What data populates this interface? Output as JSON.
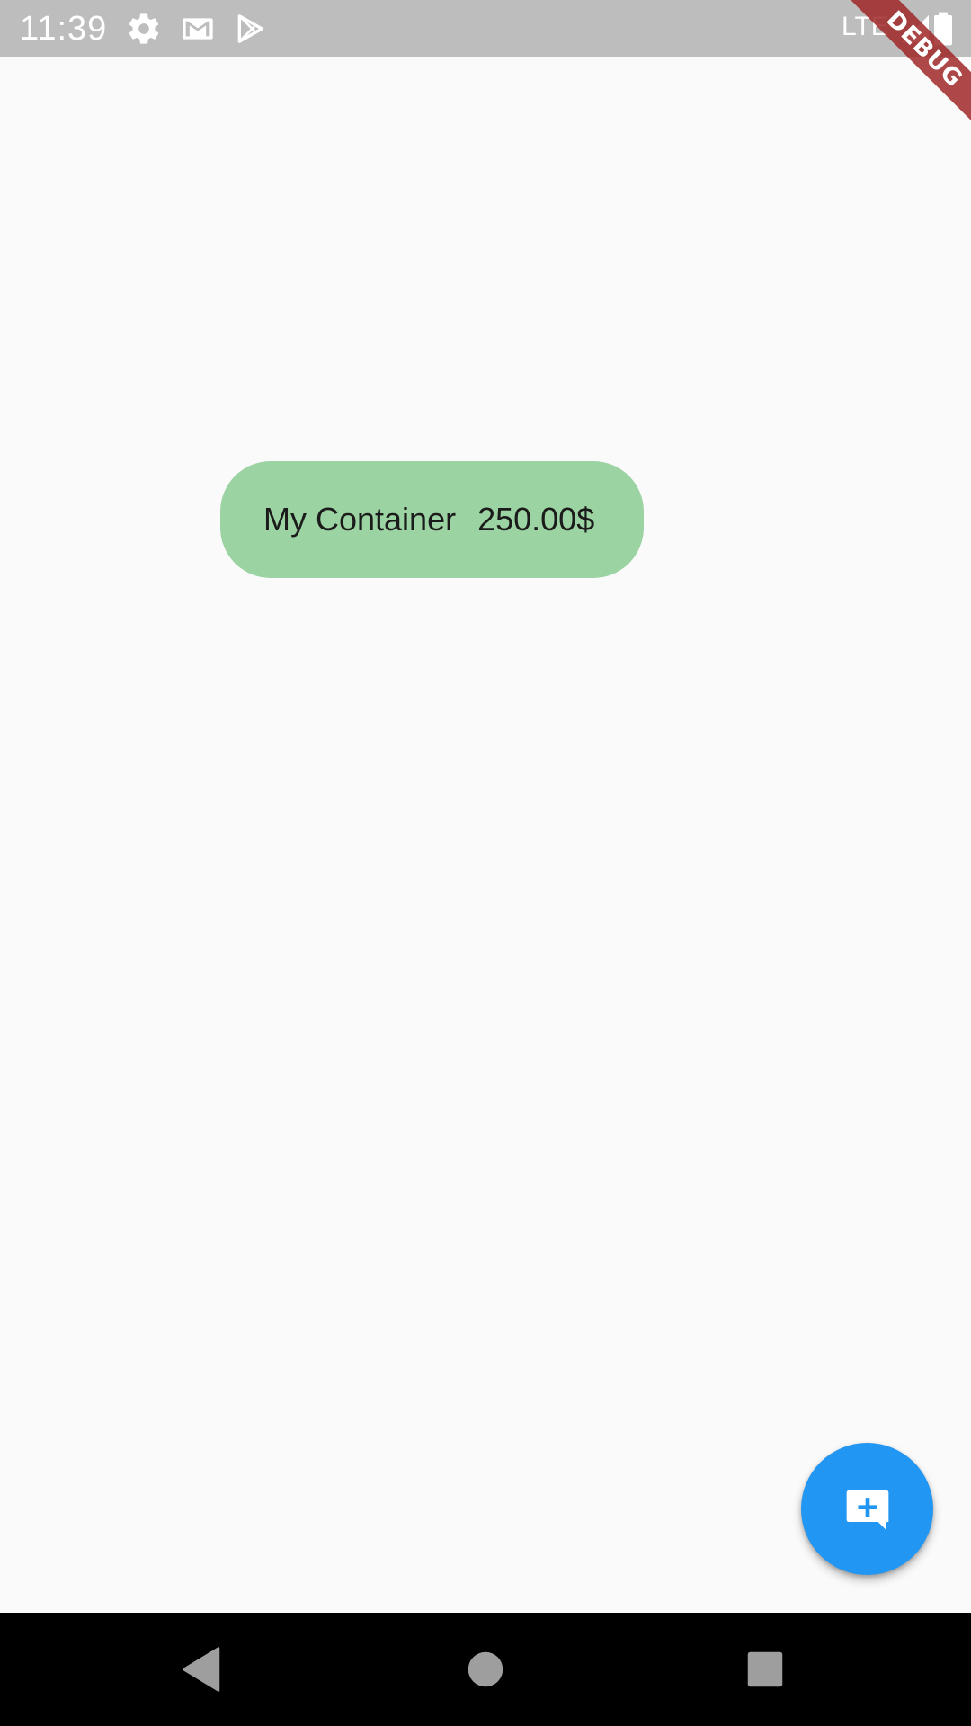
{
  "status_bar": {
    "time": "11:39",
    "network": "LTE",
    "icons": [
      "settings-icon",
      "gmail-icon",
      "play-store-icon",
      "signal-icon",
      "battery-icon"
    ]
  },
  "debug_banner": {
    "label": "DEBUG",
    "color": "#a02828"
  },
  "main": {
    "container": {
      "label": "My Container",
      "amount": "250.00$",
      "color": "#9cd3a2"
    }
  },
  "fab": {
    "icon": "add-comment-icon",
    "color": "#2196f3"
  },
  "nav_bar": {
    "buttons": [
      "back-icon",
      "home-icon",
      "recents-icon"
    ]
  },
  "colors": {
    "background": "#fafafa",
    "status_bar": "#bdbdbd",
    "nav_bar": "#000000"
  }
}
